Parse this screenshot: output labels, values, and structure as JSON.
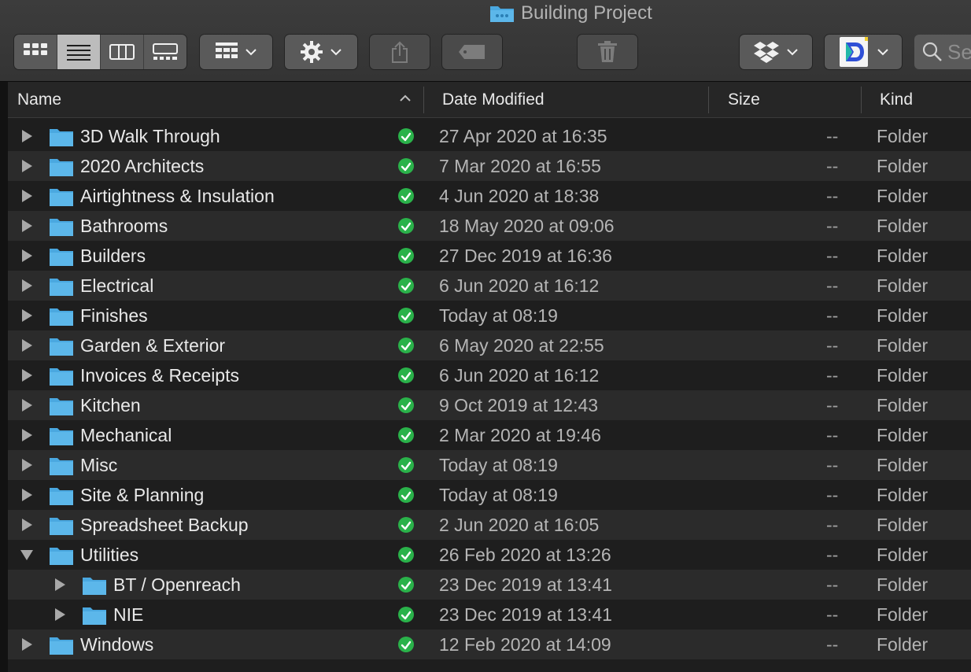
{
  "window": {
    "title": "Building Project"
  },
  "toolbar": {
    "view_modes": [
      {
        "name": "icon-view",
        "icon": "grid-icon",
        "active": false
      },
      {
        "name": "list-view",
        "icon": "list-icon",
        "active": true
      },
      {
        "name": "column-view",
        "icon": "columns-icon",
        "active": false
      },
      {
        "name": "gallery-view",
        "icon": "gallery-icon",
        "active": false
      }
    ],
    "search_placeholder": "Se"
  },
  "columns": {
    "name": "Name",
    "date": "Date Modified",
    "size": "Size",
    "kind": "Kind"
  },
  "rows": [
    {
      "name": "3D Walk Through",
      "date": "27 Apr 2020 at 16:35",
      "size": "--",
      "kind": "Folder",
      "indent": 0,
      "expanded": false
    },
    {
      "name": "2020 Architects",
      "date": "7 Mar 2020 at 16:55",
      "size": "--",
      "kind": "Folder",
      "indent": 0,
      "expanded": false
    },
    {
      "name": "Airtightness & Insulation",
      "date": "4 Jun 2020 at 18:38",
      "size": "--",
      "kind": "Folder",
      "indent": 0,
      "expanded": false
    },
    {
      "name": "Bathrooms",
      "date": "18 May 2020 at 09:06",
      "size": "--",
      "kind": "Folder",
      "indent": 0,
      "expanded": false
    },
    {
      "name": "Builders",
      "date": "27 Dec 2019 at 16:36",
      "size": "--",
      "kind": "Folder",
      "indent": 0,
      "expanded": false
    },
    {
      "name": "Electrical",
      "date": "6 Jun 2020 at 16:12",
      "size": "--",
      "kind": "Folder",
      "indent": 0,
      "expanded": false
    },
    {
      "name": "Finishes",
      "date": "Today at 08:19",
      "size": "--",
      "kind": "Folder",
      "indent": 0,
      "expanded": false
    },
    {
      "name": "Garden & Exterior",
      "date": "6 May 2020 at 22:55",
      "size": "--",
      "kind": "Folder",
      "indent": 0,
      "expanded": false
    },
    {
      "name": "Invoices & Receipts",
      "date": "6 Jun 2020 at 16:12",
      "size": "--",
      "kind": "Folder",
      "indent": 0,
      "expanded": false
    },
    {
      "name": "Kitchen",
      "date": "9 Oct 2019 at 12:43",
      "size": "--",
      "kind": "Folder",
      "indent": 0,
      "expanded": false
    },
    {
      "name": "Mechanical",
      "date": "2 Mar 2020 at 19:46",
      "size": "--",
      "kind": "Folder",
      "indent": 0,
      "expanded": false
    },
    {
      "name": "Misc",
      "date": "Today at 08:19",
      "size": "--",
      "kind": "Folder",
      "indent": 0,
      "expanded": false
    },
    {
      "name": "Site & Planning",
      "date": "Today at 08:19",
      "size": "--",
      "kind": "Folder",
      "indent": 0,
      "expanded": false
    },
    {
      "name": "Spreadsheet Backup",
      "date": "2 Jun 2020 at 16:05",
      "size": "--",
      "kind": "Folder",
      "indent": 0,
      "expanded": false
    },
    {
      "name": "Utilities",
      "date": "26 Feb 2020 at 13:26",
      "size": "--",
      "kind": "Folder",
      "indent": 0,
      "expanded": true
    },
    {
      "name": "BT / Openreach",
      "date": "23 Dec 2019 at 13:41",
      "size": "--",
      "kind": "Folder",
      "indent": 1,
      "expanded": false
    },
    {
      "name": "NIE",
      "date": "23 Dec 2019 at 13:41",
      "size": "--",
      "kind": "Folder",
      "indent": 1,
      "expanded": false
    },
    {
      "name": "Windows",
      "date": "12 Feb 2020 at 14:09",
      "size": "--",
      "kind": "Folder",
      "indent": 0,
      "expanded": false
    }
  ],
  "colors": {
    "folder": "#4aa8e0",
    "sync_ok": "#2ab24a",
    "selected_view": "#bcbcbc"
  }
}
